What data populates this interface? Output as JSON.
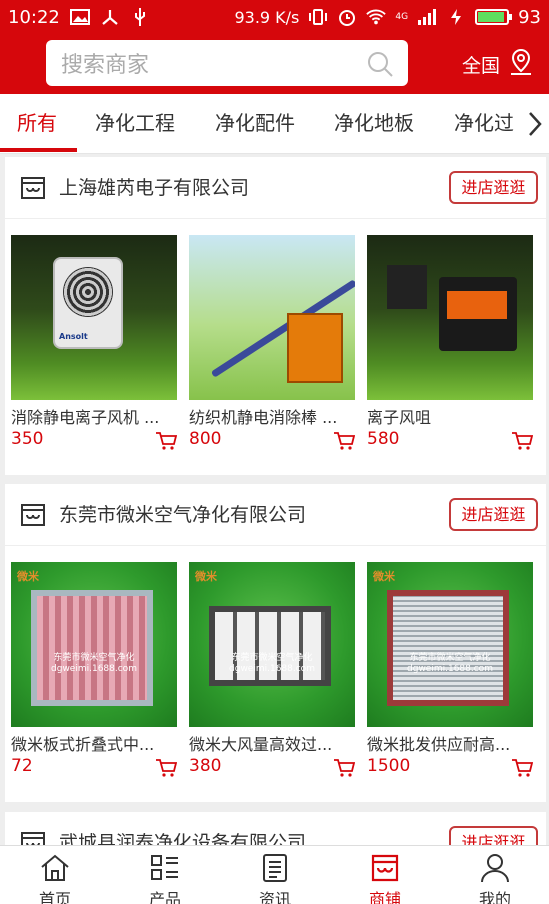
{
  "status_bar": {
    "time": "10:22",
    "speed": "93.9 K/s",
    "network": "4G",
    "battery": "93",
    "icons": [
      "image-icon",
      "usb-debug-icon",
      "usb-icon",
      "vibrate-icon",
      "alarm-icon",
      "wifi-icon",
      "signal-icon",
      "charging-icon",
      "battery-icon"
    ]
  },
  "header": {
    "search_placeholder": "搜索商家",
    "location_label": "全国",
    "colors": {
      "brand": "#d6070c"
    }
  },
  "tabs": [
    {
      "label": "所有",
      "active": true
    },
    {
      "label": "净化工程",
      "active": false
    },
    {
      "label": "净化配件",
      "active": false
    },
    {
      "label": "净化地板",
      "active": false
    },
    {
      "label": "净化过",
      "active": false
    }
  ],
  "stores": [
    {
      "name": "上海雄芮电子有限公司",
      "visit_label": "进店逛逛",
      "products": [
        {
          "title": "消除静电离子风机 ...",
          "price": "350",
          "image_brand": "Ansolt"
        },
        {
          "title": "纺织机静电消除棒 ...",
          "price": "800"
        },
        {
          "title": "离子风咀",
          "price": "580"
        }
      ]
    },
    {
      "name": "东莞市微米空气净化有限公司",
      "visit_label": "进店逛逛",
      "products": [
        {
          "title": "微米板式折叠式中...",
          "price": "72",
          "image_brand": "微米",
          "image_text": "东莞市微米空气净化",
          "image_url_text": "dgweimi.1688.com"
        },
        {
          "title": "微米大风量高效过...",
          "price": "380",
          "image_brand": "微米",
          "image_text": "东莞市微米空气净化",
          "image_url_text": "dgweimi.1688.com"
        },
        {
          "title": "微米批发供应耐高...",
          "price": "1500",
          "image_brand": "微米",
          "image_text": "东莞市微米空气净化",
          "image_url_text": "dgweimi.1688.com"
        }
      ]
    },
    {
      "name": "武城县润泰净化设备有限公司",
      "visit_label": "进店逛逛"
    }
  ],
  "bottom_nav": [
    {
      "label": "首页",
      "icon": "home-icon",
      "active": false
    },
    {
      "label": "产品",
      "icon": "grid-list-icon",
      "active": false
    },
    {
      "label": "资讯",
      "icon": "document-icon",
      "active": false
    },
    {
      "label": "商铺",
      "icon": "store-icon",
      "active": true
    },
    {
      "label": "我的",
      "icon": "user-icon",
      "active": false
    }
  ]
}
